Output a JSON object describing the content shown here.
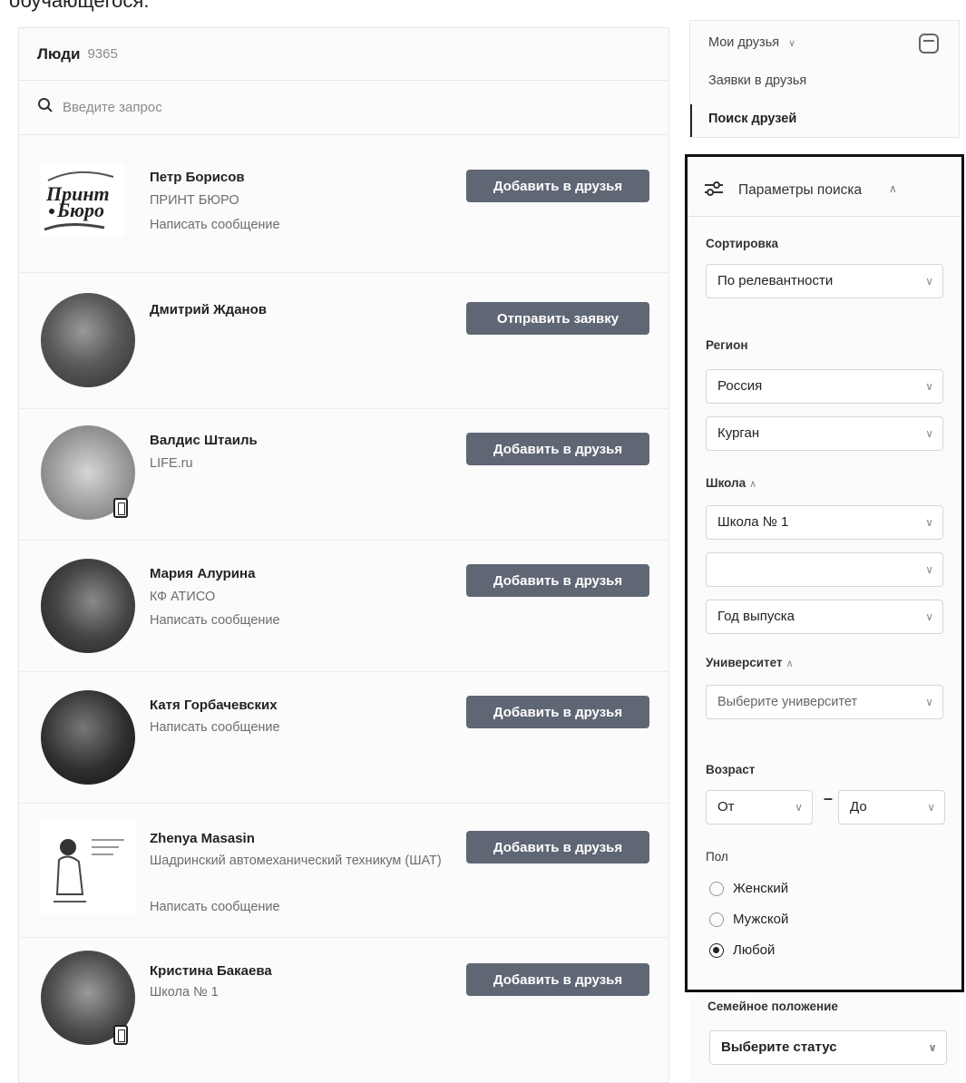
{
  "caption": "обучающегося.",
  "people": {
    "title": "Люди",
    "count": "9365",
    "search_placeholder": "Введите запрос",
    "list": [
      {
        "name": "Петр Борисов",
        "sub": "ПРИНТ БЮРО",
        "msg": "Написать сообщение",
        "button": "Добавить в друзья",
        "logo_text": "Принт Бюро"
      },
      {
        "name": "Дмитрий Жданов",
        "sub": "",
        "msg": "",
        "button": "Отправить заявку"
      },
      {
        "name": "Валдис Штаиль",
        "sub": "LIFE.ru",
        "msg": "",
        "button": "Добавить в друзья"
      },
      {
        "name": "Мария Алурина",
        "sub": "КФ АТИСО",
        "msg": "Написать сообщение",
        "button": "Добавить в друзья"
      },
      {
        "name": "Катя Горбачевских",
        "sub": "",
        "msg": "Написать сообщение",
        "button": "Добавить в друзья"
      },
      {
        "name": "Zhenya Masasin",
        "sub": "Шадринский автомеханический техникум (ШАТ)",
        "msg": "Написать сообщение",
        "button": "Добавить в друзья"
      },
      {
        "name": "Кристина Бакаева",
        "sub": "Школа № 1",
        "msg": "",
        "button": "Добавить в друзья"
      }
    ]
  },
  "menu": {
    "my_friends": "Мои друзья",
    "requests": "Заявки в друзья",
    "search": "Поиск друзей"
  },
  "filters": {
    "title": "Параметры поиска",
    "sort_label": "Сортировка",
    "sort_value": "По релевантности",
    "region_label": "Регион",
    "country": "Россия",
    "city": "Курган",
    "school_label": "Школа",
    "school": "Школа № 1",
    "school_class": "",
    "graduation_year": "Год выпуска",
    "university_label": "Университет",
    "university_placeholder": "Выберите университет",
    "age_label": "Возраст",
    "age_from": "От",
    "age_to": "До",
    "gender_label": "Пол",
    "gender_female": "Женский",
    "gender_male": "Мужской",
    "gender_any": "Любой",
    "gender_selected": "Любой",
    "family_label": "Семейное положение",
    "family_placeholder": "Выберите статус"
  }
}
